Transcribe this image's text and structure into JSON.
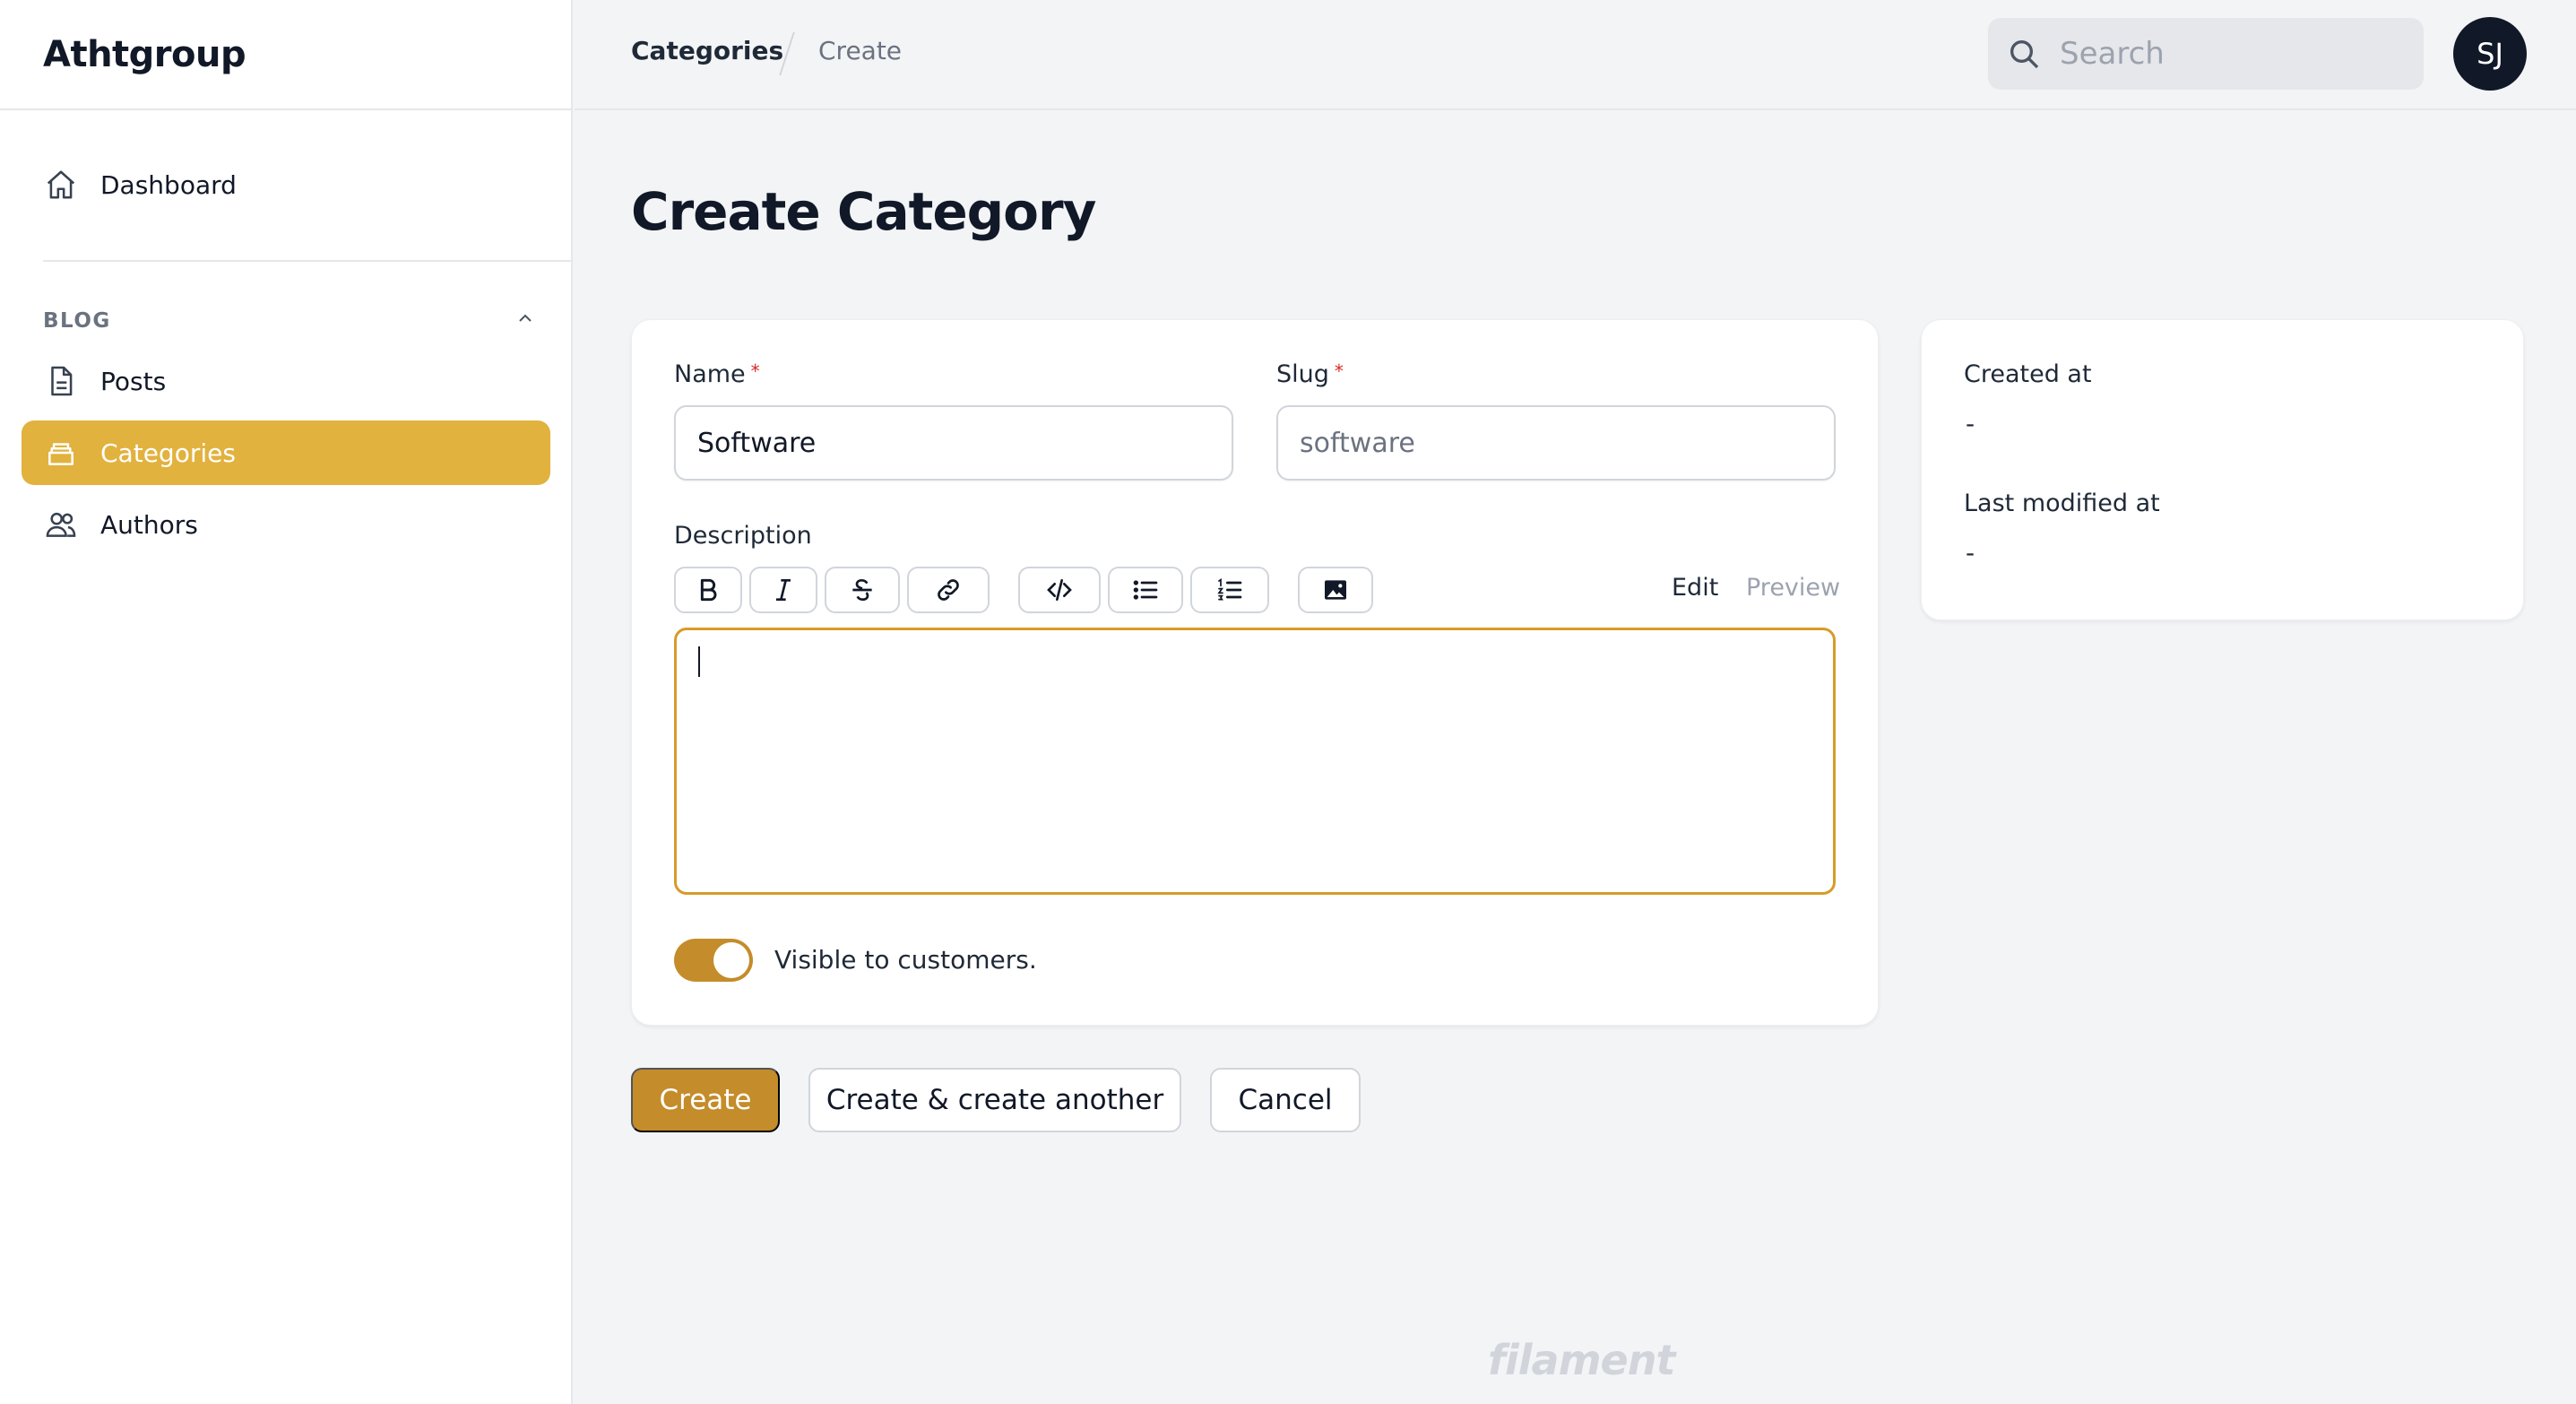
{
  "brand": "Athtgroup",
  "sidebar": {
    "dashboard_label": "Dashboard",
    "group_label": "BLOG",
    "items": [
      {
        "label": "Posts",
        "icon": "document-icon"
      },
      {
        "label": "Categories",
        "icon": "stack-icon",
        "active": true
      },
      {
        "label": "Authors",
        "icon": "users-icon"
      }
    ]
  },
  "topbar": {
    "breadcrumb": [
      "Categories",
      "Create"
    ],
    "search_placeholder": "Search",
    "avatar_initials": "SJ"
  },
  "page": {
    "title": "Create Category"
  },
  "form": {
    "name_label": "Name",
    "name_value": "Software",
    "required_mark": "*",
    "slug_label": "Slug",
    "slug_placeholder": "software",
    "description_label": "Description",
    "toolbar": [
      "bold-icon",
      "italic-icon",
      "strikethrough-icon",
      "link-icon",
      "code-icon",
      "bullet-list-icon",
      "ordered-list-icon",
      "image-icon"
    ],
    "tab_edit": "Edit",
    "tab_preview": "Preview",
    "visible_label": "Visible to customers.",
    "visible_on": true
  },
  "meta": {
    "created_label": "Created at",
    "created_value": "-",
    "modified_label": "Last modified at",
    "modified_value": "-"
  },
  "actions": {
    "create": "Create",
    "create_another": "Create & create another",
    "cancel": "Cancel"
  },
  "footer": {
    "logo_text": "filament"
  },
  "colors": {
    "accent": "#e2b23e",
    "primary_button": "#c48c2a",
    "focus_border": "#d89b2a"
  }
}
